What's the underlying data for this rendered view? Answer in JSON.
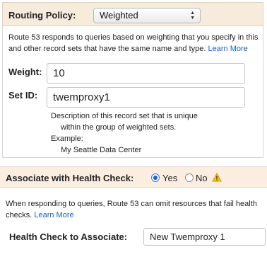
{
  "routing": {
    "label": "Routing Policy:",
    "selected": "Weighted"
  },
  "weighted": {
    "description": "Route 53 responds to queries based on weighting that you specify in this and other record sets that have the same name and type.",
    "learn_more": "Learn More",
    "weight_label": "Weight:",
    "weight_value": "10",
    "setid_label": "Set ID:",
    "setid_value": "twemproxy1",
    "help_line1": "Description of this record set that is unique",
    "help_line2": "within the group of weighted sets.",
    "help_example": "Example:",
    "help_example_value": "My Seattle Data Center"
  },
  "health": {
    "label": "Associate with Health Check:",
    "yes_label": "Yes",
    "no_label": "No",
    "selected": "Yes",
    "warning_icon": "warning-icon",
    "description": "When responding to queries, Route 53 can omit resources that fail health checks.",
    "learn_more": "Learn More",
    "associate_label": "Health Check to Associate:",
    "associate_value": "New Twemproxy 1"
  }
}
